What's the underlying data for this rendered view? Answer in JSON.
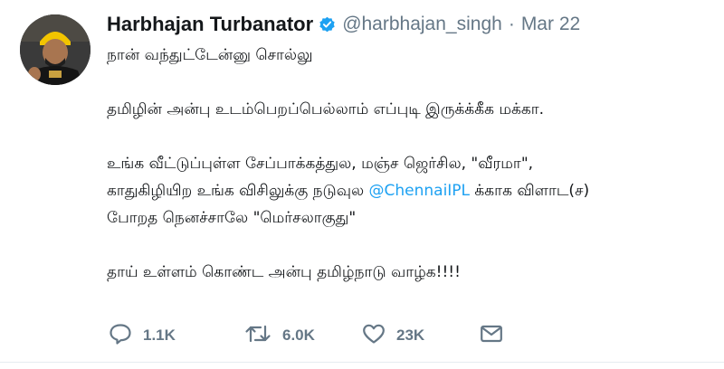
{
  "tweet": {
    "display_name": "Harbhajan Turbanator",
    "handle": "@harbhajan_singh",
    "separator": "·",
    "date": "Mar 22",
    "lines": {
      "l1": "நான் வந்துட்டேன்னு சொல்லு",
      "l2": "தமிழின் அன்பு உடம்பெறப்பெல்லாம் எப்புடி இருக்க்கீக மக்கா.",
      "l3": "உங்க வீட்டுப்புள்ள சேப்பாக்கத்துல, மஞ்ச ஜெர்சில, \"வீரமா\",",
      "l4_before": "காதுகிழியிற உங்க விசிலுக்கு நடுவுல ",
      "l4_mention": "@ChennaiIPL",
      "l4_after": " க்காக விளாட(ச)",
      "l5": "போறத நெனச்சாலே \"மெர்சலாகுது\"",
      "l6": "தாய் உள்ளம் கொண்ட அன்பு தமிழ்நாடு வாழ்க!!!!"
    },
    "actions": {
      "reply_count": "1.1K",
      "retweet_count": "6.0K",
      "like_count": "23K"
    }
  },
  "colors": {
    "text": "#14171a",
    "muted": "#657786",
    "link": "#1da1f2",
    "verified": "#1da1f2"
  },
  "icons": [
    "verified-badge-icon",
    "reply-icon",
    "retweet-icon",
    "like-icon",
    "direct-message-icon"
  ]
}
